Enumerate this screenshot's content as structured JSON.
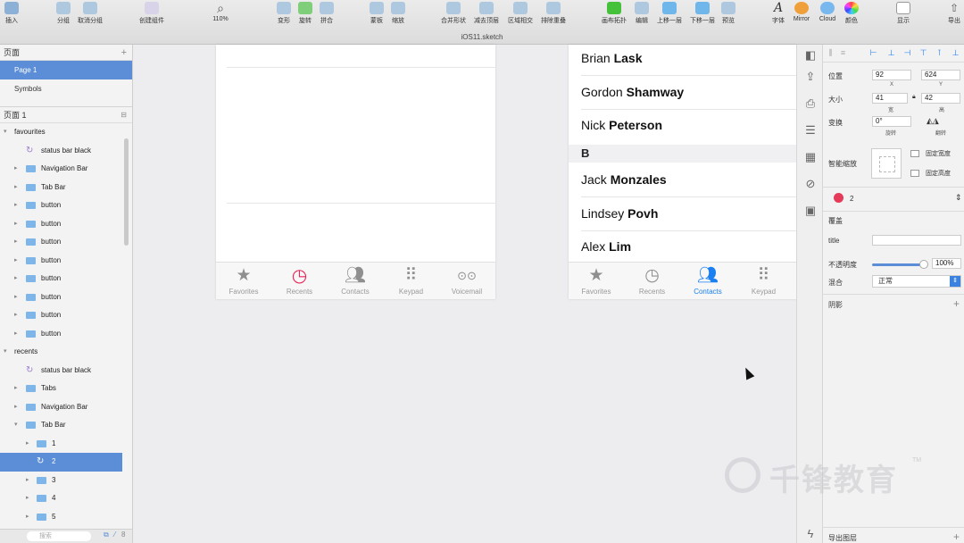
{
  "toolbar": {
    "insert": "插入",
    "group": "分组",
    "ungroup": "取消分组",
    "create_symbol": "创建组件",
    "zoom_value": "110%",
    "transform": "变形",
    "rotate": "旋转",
    "flatten": "拼合",
    "mask": "蒙板",
    "scale": "缩放",
    "union": "合并形状",
    "subtract": "减去顶层",
    "intersect": "区域相交",
    "difference": "排除重叠",
    "artboard": "画布拓扑",
    "edit": "编辑",
    "forward": "上移一层",
    "backward": "下移一层",
    "preview": "预览",
    "text": "字体",
    "mirror": "Mirror",
    "cloud": "Cloud",
    "colors": "颜色",
    "view": "显示",
    "export": "导出",
    "doc_title": "iOS11.sketch"
  },
  "sidebar": {
    "pages_header": "页面",
    "pages": [
      "Page 1",
      "Symbols"
    ],
    "layers_header": "页面 1",
    "layers": [
      {
        "label": "favourites",
        "indent": 0,
        "kind": "group",
        "expanded": true
      },
      {
        "label": "status bar black",
        "indent": 1,
        "kind": "symbol"
      },
      {
        "label": "Navigation Bar",
        "indent": 1,
        "kind": "folder"
      },
      {
        "label": "Tab Bar",
        "indent": 1,
        "kind": "folder"
      },
      {
        "label": "button",
        "indent": 1,
        "kind": "folder"
      },
      {
        "label": "button",
        "indent": 1,
        "kind": "folder"
      },
      {
        "label": "button",
        "indent": 1,
        "kind": "folder"
      },
      {
        "label": "button",
        "indent": 1,
        "kind": "folder"
      },
      {
        "label": "button",
        "indent": 1,
        "kind": "folder"
      },
      {
        "label": "button",
        "indent": 1,
        "kind": "folder"
      },
      {
        "label": "button",
        "indent": 1,
        "kind": "folder"
      },
      {
        "label": "button",
        "indent": 1,
        "kind": "folder"
      },
      {
        "label": "recents",
        "indent": 0,
        "kind": "group",
        "expanded": true
      },
      {
        "label": "status bar black",
        "indent": 1,
        "kind": "symbol"
      },
      {
        "label": "Tabs",
        "indent": 1,
        "kind": "folder"
      },
      {
        "label": "Navigation Bar",
        "indent": 1,
        "kind": "folder"
      },
      {
        "label": "Tab Bar",
        "indent": 1,
        "kind": "folder",
        "expanded": true
      },
      {
        "label": "1",
        "indent": 2,
        "kind": "folder"
      },
      {
        "label": "2",
        "indent": 2,
        "kind": "symbol",
        "selected": true
      },
      {
        "label": "3",
        "indent": 2,
        "kind": "folder"
      },
      {
        "label": "4",
        "indent": 2,
        "kind": "folder"
      },
      {
        "label": "5",
        "indent": 2,
        "kind": "folder"
      }
    ],
    "search_placeholder": "搜索"
  },
  "canvas": {
    "left_artboard": {
      "tabs": [
        "Favorites",
        "Recents",
        "Contacts",
        "Keypad",
        "Voicemail"
      ]
    },
    "right_artboard": {
      "contacts_top": [
        {
          "first": "Brian",
          "last": "Lask"
        },
        {
          "first": "Gordon",
          "last": "Shamway"
        },
        {
          "first": "Nick",
          "last": "Peterson"
        }
      ],
      "section": "B",
      "contacts_b": [
        {
          "first": "Jack",
          "last": "Monzales"
        },
        {
          "first": "Lindsey",
          "last": "Povh"
        },
        {
          "first": "Alex",
          "last": "Lim"
        }
      ],
      "tabs": [
        "Favorites",
        "Recents",
        "Contacts",
        "Keypad"
      ],
      "active_tab": "Contacts"
    }
  },
  "inspector": {
    "position_label": "位置",
    "x_value": "92",
    "y_value": "624",
    "x_label": "X",
    "y_label": "Y",
    "size_label": "大小",
    "w_value": "41",
    "h_value": "42",
    "w_label": "宽",
    "h_label": "高",
    "transform_label": "变换",
    "rotation_value": "0°",
    "rotate_label": "旋转",
    "flip_label": "翻转",
    "resizing_label": "智能缩放",
    "fixed_width": "固定宽度",
    "fixed_height": "固定高度",
    "symbol_name": "2",
    "overrides_label": "覆盖",
    "title_label": "title",
    "opacity_label": "不透明度",
    "opacity_value": "100%",
    "blend_label": "混合",
    "blend_value": "正常",
    "shadow_label": "阴影",
    "export_label": "导出图层",
    "accent": "#1a7ff0",
    "symbol_color": "#e53a58"
  },
  "watermark": {
    "text": "千锋教育",
    "tm": "TM"
  }
}
